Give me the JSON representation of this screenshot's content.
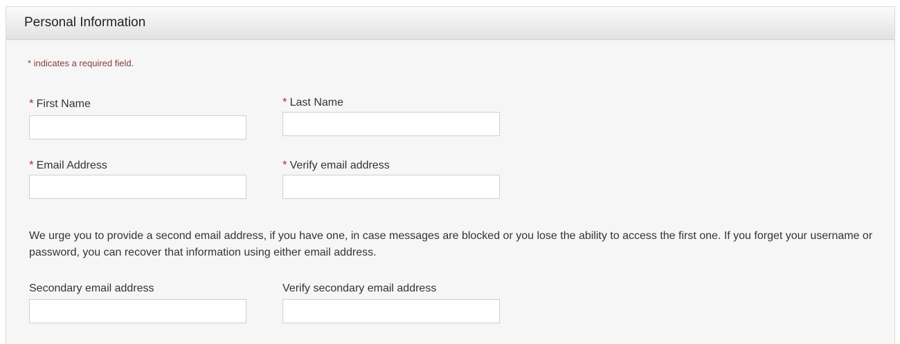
{
  "panel": {
    "title": "Personal Information"
  },
  "required_note": "* indicates a required field.",
  "fields": {
    "first_name": {
      "star": "*",
      "label": "First Name",
      "value": ""
    },
    "last_name": {
      "star": "*",
      "label": "Last Name",
      "value": ""
    },
    "email": {
      "star": "*",
      "label": "Email Address",
      "value": ""
    },
    "verify_email": {
      "star": "*",
      "label": "Verify email address",
      "value": ""
    },
    "secondary_email": {
      "label": "Secondary email address",
      "value": ""
    },
    "verify_secondary_email": {
      "label": "Verify secondary email address",
      "value": ""
    }
  },
  "info_text": "We urge you to provide a second email address, if you have one, in case messages are blocked or you lose the ability to access the first one. If you forget your username or password, you can recover that information using either email address.",
  "colors": {
    "required_star": "#a33a3a",
    "required_note": "#8a3a3a",
    "panel_bg": "#f6f6f6"
  }
}
